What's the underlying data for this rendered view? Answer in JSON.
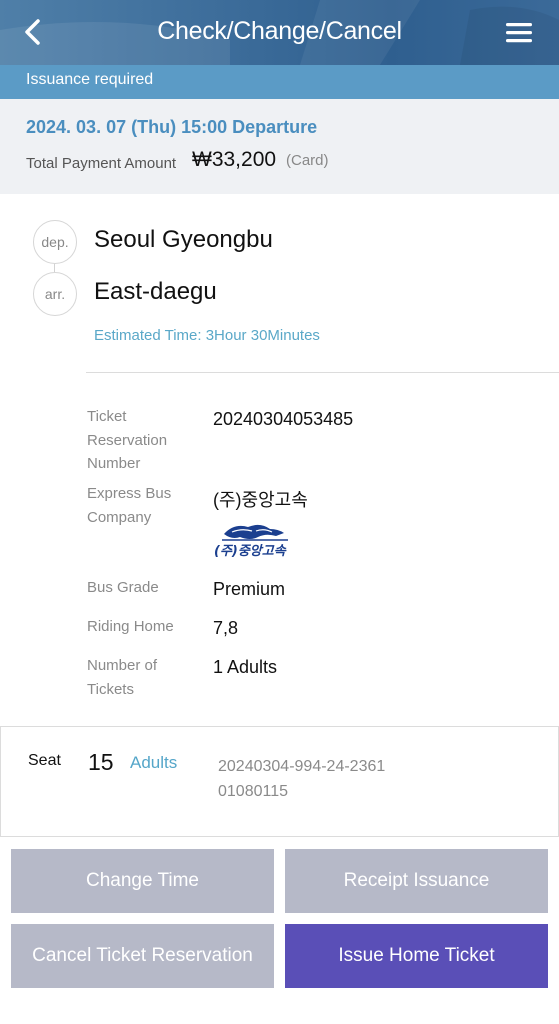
{
  "header": {
    "title": "Check/Change/Cancel",
    "back_icon": "chevron-left-icon",
    "menu_icon": "hamburger-menu-icon"
  },
  "status_bar": {
    "text": "Issuance required"
  },
  "summary": {
    "departure": "2024. 03. 07 (Thu) 15:00 Departure",
    "payment_label": "Total Payment Amount",
    "payment_amount": "₩33,200",
    "payment_method": "(Card)"
  },
  "route": {
    "dep_label": "dep.",
    "dep_name": "Seoul Gyeongbu",
    "arr_label": "arr.",
    "arr_name": "East-daegu",
    "estimated_time": "Estimated Time: 3Hour 30Minutes"
  },
  "details": {
    "reservation_label": "Ticket Reservation Number",
    "reservation_value": "20240304053485",
    "company_label": "Express Bus Company",
    "company_value": "(주)중앙고속",
    "company_logo_text": "(주)중앙고속",
    "grade_label": "Bus Grade",
    "grade_value": "Premium",
    "riding_label": "Riding Home",
    "riding_value": "7,8",
    "tickets_label": "Number of Tickets",
    "tickets_value": "1 Adults"
  },
  "seat": {
    "label": "Seat",
    "number": "15",
    "type": "Adults",
    "code_line1": "20240304-994-24-2361",
    "code_line2": "01080115"
  },
  "buttons": {
    "change_time": "Change Time",
    "receipt_issuance": "Receipt Issuance",
    "cancel_reservation": "Cancel Ticket Reservation",
    "issue_home_ticket": "Issue Home Ticket"
  },
  "colors": {
    "header_blue": "#3f6f9c",
    "status_blue": "#5b9bc6",
    "accent_blue": "#4a8ebf",
    "button_grey": "#b6b9c8",
    "button_purple": "#5a4fb7"
  }
}
